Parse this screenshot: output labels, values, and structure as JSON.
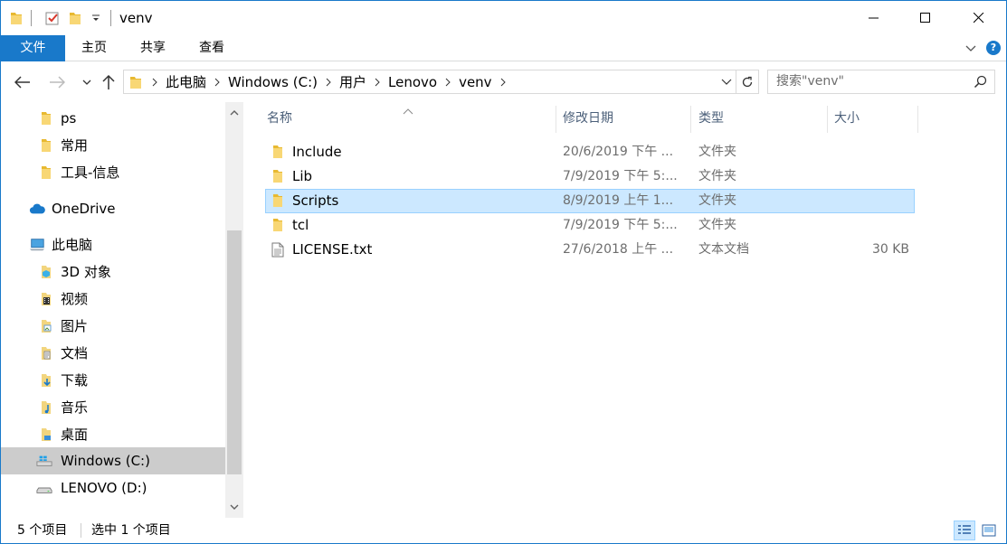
{
  "window": {
    "title": "venv",
    "accent": "#1979ca"
  },
  "quick_access": {
    "icons": [
      "folder-icon",
      "properties-check-icon",
      "new-folder-icon",
      "customize-dropdown-icon"
    ]
  },
  "ribbon": {
    "tabs": [
      {
        "label": "文件"
      },
      {
        "label": "主页"
      },
      {
        "label": "共享"
      },
      {
        "label": "查看"
      }
    ]
  },
  "address": {
    "crumbs": [
      "此电脑",
      "Windows (C:)",
      "用户",
      "Lenovo",
      "venv"
    ],
    "search_placeholder": "搜索\"venv\""
  },
  "nav": {
    "items": [
      {
        "label": "ps",
        "icon": "folder-icon"
      },
      {
        "label": "常用",
        "icon": "folder-icon"
      },
      {
        "label": "工具-信息",
        "icon": "folder-icon"
      },
      {
        "label": "OneDrive",
        "icon": "cloud-icon"
      },
      {
        "label": "此电脑",
        "icon": "computer-icon"
      },
      {
        "label": "3D 对象",
        "icon": "3d-objects-icon"
      },
      {
        "label": "视频",
        "icon": "video-icon"
      },
      {
        "label": "图片",
        "icon": "pictures-icon"
      },
      {
        "label": "文档",
        "icon": "documents-icon"
      },
      {
        "label": "下载",
        "icon": "downloads-icon"
      },
      {
        "label": "音乐",
        "icon": "music-icon"
      },
      {
        "label": "桌面",
        "icon": "desktop-icon"
      },
      {
        "label": "Windows (C:)",
        "icon": "windows-drive-icon",
        "selected": true
      },
      {
        "label": "LENOVO (D:)",
        "icon": "drive-icon"
      }
    ]
  },
  "columns": {
    "name": "名称",
    "date": "修改日期",
    "type": "类型",
    "size": "大小"
  },
  "files": [
    {
      "name": "Include",
      "date": "20/6/2019 下午 ...",
      "type": "文件夹",
      "size": "",
      "icon": "folder-icon"
    },
    {
      "name": "Lib",
      "date": "7/9/2019 下午 5:...",
      "type": "文件夹",
      "size": "",
      "icon": "folder-icon"
    },
    {
      "name": "Scripts",
      "date": "8/9/2019 上午 1...",
      "type": "文件夹",
      "size": "",
      "icon": "folder-icon",
      "selected": true
    },
    {
      "name": "tcl",
      "date": "7/9/2019 下午 5:...",
      "type": "文件夹",
      "size": "",
      "icon": "folder-icon"
    },
    {
      "name": "LICENSE.txt",
      "date": "27/6/2018 上午 ...",
      "type": "文本文档",
      "size": "30 KB",
      "icon": "text-file-icon"
    }
  ],
  "status": {
    "count": "5 个项目",
    "selection": "选中 1 个项目"
  }
}
